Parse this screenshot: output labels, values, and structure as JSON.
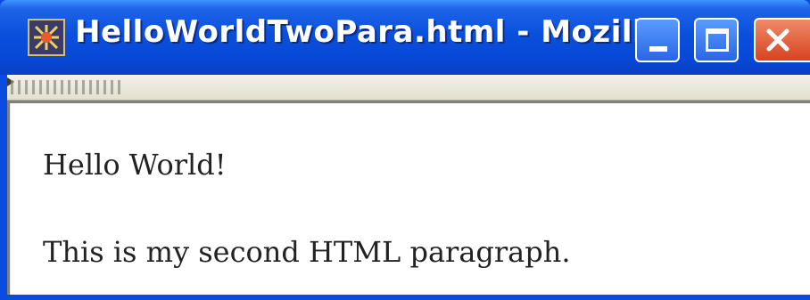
{
  "window": {
    "title": "HelloWorldTwoPara.html - Mozilla",
    "app_icon": "mozilla-app-icon",
    "controls": {
      "minimize_icon": "minimize-icon",
      "maximize_icon": "maximize-icon",
      "close_icon": "close-icon"
    }
  },
  "page": {
    "paragraphs": [
      "Hello World!",
      "This is my second HTML paragraph."
    ]
  },
  "colors": {
    "titlebar": "#0a50dc",
    "close_button": "#d8431f",
    "page_background": "#ffffff"
  }
}
